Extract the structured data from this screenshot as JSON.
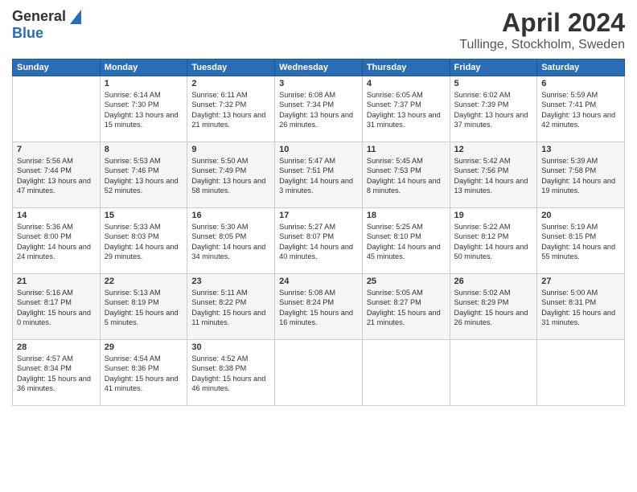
{
  "logo": {
    "general": "General",
    "blue": "Blue"
  },
  "header": {
    "month": "April 2024",
    "location": "Tullinge, Stockholm, Sweden"
  },
  "weekdays": [
    "Sunday",
    "Monday",
    "Tuesday",
    "Wednesday",
    "Thursday",
    "Friday",
    "Saturday"
  ],
  "weeks": [
    [
      {
        "day": "",
        "sunrise": "",
        "sunset": "",
        "daylight": ""
      },
      {
        "day": "1",
        "sunrise": "Sunrise: 6:14 AM",
        "sunset": "Sunset: 7:30 PM",
        "daylight": "Daylight: 13 hours and 15 minutes."
      },
      {
        "day": "2",
        "sunrise": "Sunrise: 6:11 AM",
        "sunset": "Sunset: 7:32 PM",
        "daylight": "Daylight: 13 hours and 21 minutes."
      },
      {
        "day": "3",
        "sunrise": "Sunrise: 6:08 AM",
        "sunset": "Sunset: 7:34 PM",
        "daylight": "Daylight: 13 hours and 26 minutes."
      },
      {
        "day": "4",
        "sunrise": "Sunrise: 6:05 AM",
        "sunset": "Sunset: 7:37 PM",
        "daylight": "Daylight: 13 hours and 31 minutes."
      },
      {
        "day": "5",
        "sunrise": "Sunrise: 6:02 AM",
        "sunset": "Sunset: 7:39 PM",
        "daylight": "Daylight: 13 hours and 37 minutes."
      },
      {
        "day": "6",
        "sunrise": "Sunrise: 5:59 AM",
        "sunset": "Sunset: 7:41 PM",
        "daylight": "Daylight: 13 hours and 42 minutes."
      }
    ],
    [
      {
        "day": "7",
        "sunrise": "Sunrise: 5:56 AM",
        "sunset": "Sunset: 7:44 PM",
        "daylight": "Daylight: 13 hours and 47 minutes."
      },
      {
        "day": "8",
        "sunrise": "Sunrise: 5:53 AM",
        "sunset": "Sunset: 7:46 PM",
        "daylight": "Daylight: 13 hours and 52 minutes."
      },
      {
        "day": "9",
        "sunrise": "Sunrise: 5:50 AM",
        "sunset": "Sunset: 7:49 PM",
        "daylight": "Daylight: 13 hours and 58 minutes."
      },
      {
        "day": "10",
        "sunrise": "Sunrise: 5:47 AM",
        "sunset": "Sunset: 7:51 PM",
        "daylight": "Daylight: 14 hours and 3 minutes."
      },
      {
        "day": "11",
        "sunrise": "Sunrise: 5:45 AM",
        "sunset": "Sunset: 7:53 PM",
        "daylight": "Daylight: 14 hours and 8 minutes."
      },
      {
        "day": "12",
        "sunrise": "Sunrise: 5:42 AM",
        "sunset": "Sunset: 7:56 PM",
        "daylight": "Daylight: 14 hours and 13 minutes."
      },
      {
        "day": "13",
        "sunrise": "Sunrise: 5:39 AM",
        "sunset": "Sunset: 7:58 PM",
        "daylight": "Daylight: 14 hours and 19 minutes."
      }
    ],
    [
      {
        "day": "14",
        "sunrise": "Sunrise: 5:36 AM",
        "sunset": "Sunset: 8:00 PM",
        "daylight": "Daylight: 14 hours and 24 minutes."
      },
      {
        "day": "15",
        "sunrise": "Sunrise: 5:33 AM",
        "sunset": "Sunset: 8:03 PM",
        "daylight": "Daylight: 14 hours and 29 minutes."
      },
      {
        "day": "16",
        "sunrise": "Sunrise: 5:30 AM",
        "sunset": "Sunset: 8:05 PM",
        "daylight": "Daylight: 14 hours and 34 minutes."
      },
      {
        "day": "17",
        "sunrise": "Sunrise: 5:27 AM",
        "sunset": "Sunset: 8:07 PM",
        "daylight": "Daylight: 14 hours and 40 minutes."
      },
      {
        "day": "18",
        "sunrise": "Sunrise: 5:25 AM",
        "sunset": "Sunset: 8:10 PM",
        "daylight": "Daylight: 14 hours and 45 minutes."
      },
      {
        "day": "19",
        "sunrise": "Sunrise: 5:22 AM",
        "sunset": "Sunset: 8:12 PM",
        "daylight": "Daylight: 14 hours and 50 minutes."
      },
      {
        "day": "20",
        "sunrise": "Sunrise: 5:19 AM",
        "sunset": "Sunset: 8:15 PM",
        "daylight": "Daylight: 14 hours and 55 minutes."
      }
    ],
    [
      {
        "day": "21",
        "sunrise": "Sunrise: 5:16 AM",
        "sunset": "Sunset: 8:17 PM",
        "daylight": "Daylight: 15 hours and 0 minutes."
      },
      {
        "day": "22",
        "sunrise": "Sunrise: 5:13 AM",
        "sunset": "Sunset: 8:19 PM",
        "daylight": "Daylight: 15 hours and 5 minutes."
      },
      {
        "day": "23",
        "sunrise": "Sunrise: 5:11 AM",
        "sunset": "Sunset: 8:22 PM",
        "daylight": "Daylight: 15 hours and 11 minutes."
      },
      {
        "day": "24",
        "sunrise": "Sunrise: 5:08 AM",
        "sunset": "Sunset: 8:24 PM",
        "daylight": "Daylight: 15 hours and 16 minutes."
      },
      {
        "day": "25",
        "sunrise": "Sunrise: 5:05 AM",
        "sunset": "Sunset: 8:27 PM",
        "daylight": "Daylight: 15 hours and 21 minutes."
      },
      {
        "day": "26",
        "sunrise": "Sunrise: 5:02 AM",
        "sunset": "Sunset: 8:29 PM",
        "daylight": "Daylight: 15 hours and 26 minutes."
      },
      {
        "day": "27",
        "sunrise": "Sunrise: 5:00 AM",
        "sunset": "Sunset: 8:31 PM",
        "daylight": "Daylight: 15 hours and 31 minutes."
      }
    ],
    [
      {
        "day": "28",
        "sunrise": "Sunrise: 4:57 AM",
        "sunset": "Sunset: 8:34 PM",
        "daylight": "Daylight: 15 hours and 36 minutes."
      },
      {
        "day": "29",
        "sunrise": "Sunrise: 4:54 AM",
        "sunset": "Sunset: 8:36 PM",
        "daylight": "Daylight: 15 hours and 41 minutes."
      },
      {
        "day": "30",
        "sunrise": "Sunrise: 4:52 AM",
        "sunset": "Sunset: 8:38 PM",
        "daylight": "Daylight: 15 hours and 46 minutes."
      },
      {
        "day": "",
        "sunrise": "",
        "sunset": "",
        "daylight": ""
      },
      {
        "day": "",
        "sunrise": "",
        "sunset": "",
        "daylight": ""
      },
      {
        "day": "",
        "sunrise": "",
        "sunset": "",
        "daylight": ""
      },
      {
        "day": "",
        "sunrise": "",
        "sunset": "",
        "daylight": ""
      }
    ]
  ]
}
